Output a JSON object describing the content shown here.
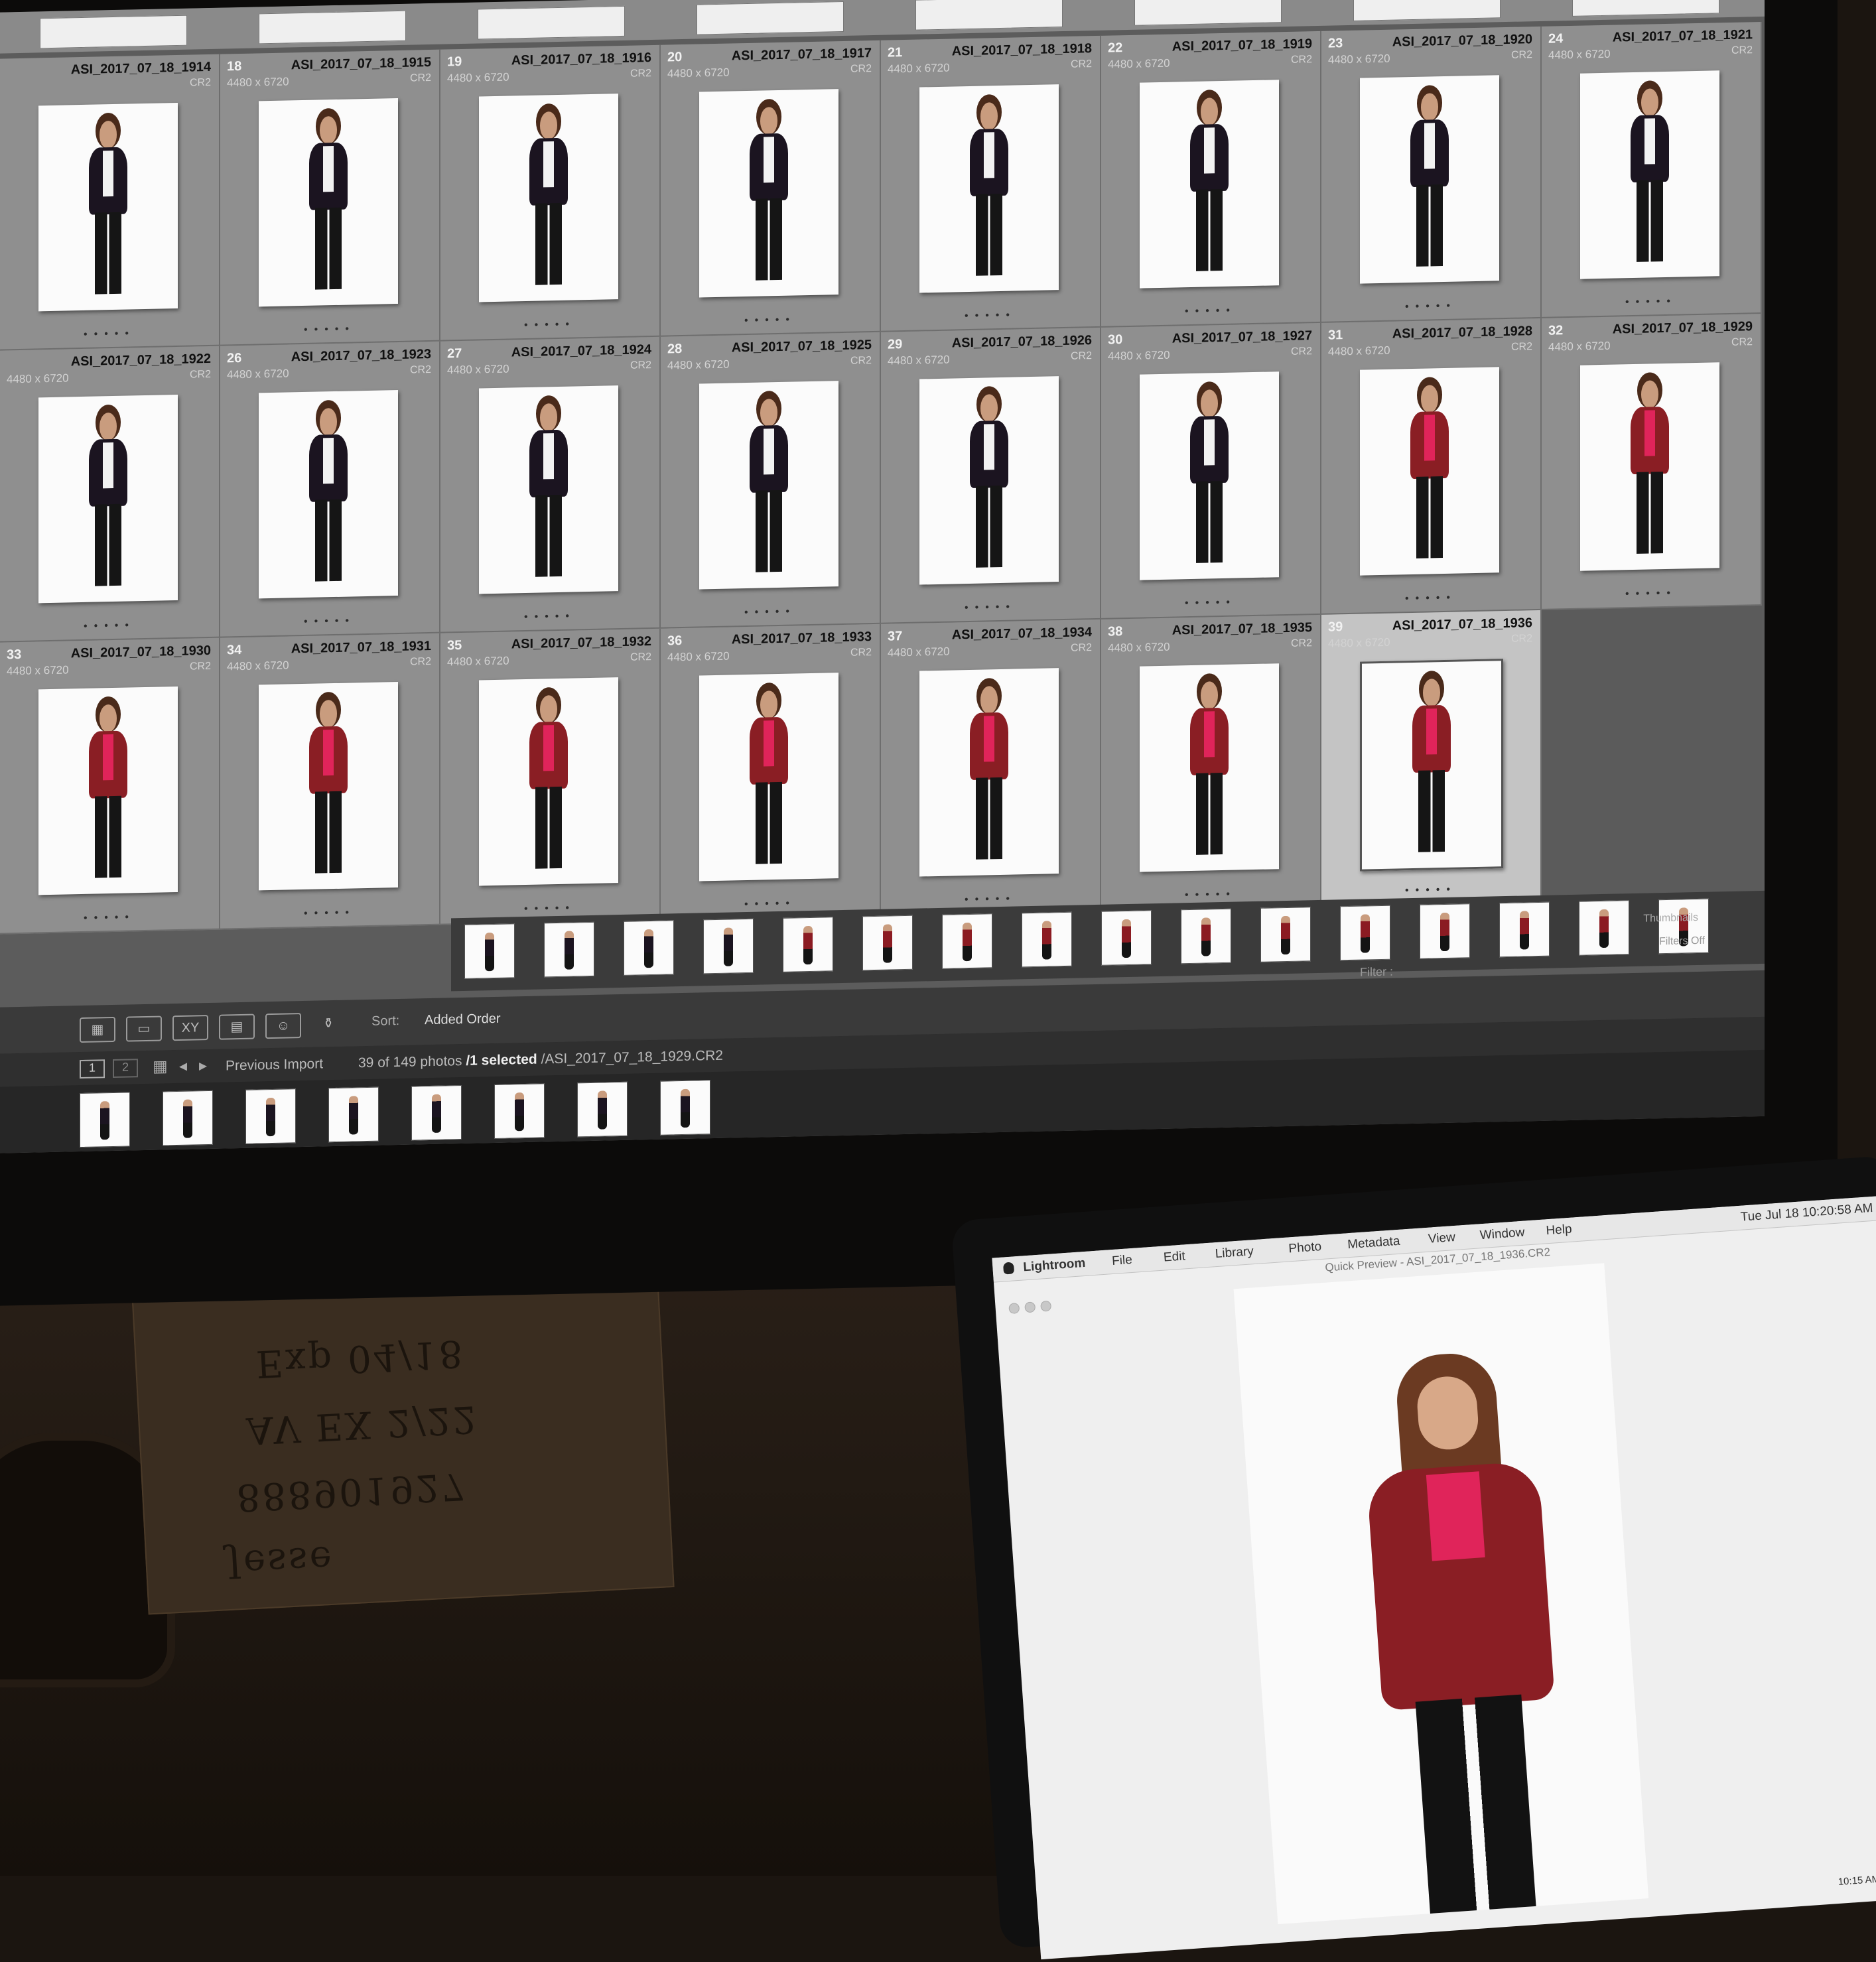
{
  "top_strip_cells": 8,
  "grid_rows": [
    [
      {
        "num": "",
        "file": "ASI_2017_07_18_1914",
        "dims": "",
        "ext": "CR2",
        "outfit": "black"
      },
      {
        "num": "18",
        "file": "ASI_2017_07_18_1915",
        "dims": "4480 x 6720",
        "ext": "CR2",
        "outfit": "black"
      },
      {
        "num": "19",
        "file": "ASI_2017_07_18_1916",
        "dims": "4480 x 6720",
        "ext": "CR2",
        "outfit": "black"
      },
      {
        "num": "20",
        "file": "ASI_2017_07_18_1917",
        "dims": "4480 x 6720",
        "ext": "CR2",
        "outfit": "black"
      },
      {
        "num": "21",
        "file": "ASI_2017_07_18_1918",
        "dims": "4480 x 6720",
        "ext": "CR2",
        "outfit": "black"
      },
      {
        "num": "22",
        "file": "ASI_2017_07_18_1919",
        "dims": "4480 x 6720",
        "ext": "CR2",
        "outfit": "black"
      },
      {
        "num": "23",
        "file": "ASI_2017_07_18_1920",
        "dims": "4480 x 6720",
        "ext": "CR2",
        "outfit": "black"
      },
      {
        "num": "24",
        "file": "ASI_2017_07_18_1921",
        "dims": "4480 x 6720",
        "ext": "CR2",
        "outfit": "black"
      }
    ],
    [
      {
        "num": "",
        "file": "ASI_2017_07_18_1922",
        "dims": "4480 x 6720",
        "ext": "CR2",
        "outfit": "black"
      },
      {
        "num": "26",
        "file": "ASI_2017_07_18_1923",
        "dims": "4480 x 6720",
        "ext": "CR2",
        "outfit": "black"
      },
      {
        "num": "27",
        "file": "ASI_2017_07_18_1924",
        "dims": "4480 x 6720",
        "ext": "CR2",
        "outfit": "black"
      },
      {
        "num": "28",
        "file": "ASI_2017_07_18_1925",
        "dims": "4480 x 6720",
        "ext": "CR2",
        "outfit": "black"
      },
      {
        "num": "29",
        "file": "ASI_2017_07_18_1926",
        "dims": "4480 x 6720",
        "ext": "CR2",
        "outfit": "black"
      },
      {
        "num": "30",
        "file": "ASI_2017_07_18_1927",
        "dims": "4480 x 6720",
        "ext": "CR2",
        "outfit": "black"
      },
      {
        "num": "31",
        "file": "ASI_2017_07_18_1928",
        "dims": "4480 x 6720",
        "ext": "CR2",
        "outfit": "red"
      },
      {
        "num": "32",
        "file": "ASI_2017_07_18_1929",
        "dims": "4480 x 6720",
        "ext": "CR2",
        "outfit": "red"
      }
    ],
    [
      {
        "num": "33",
        "file": "ASI_2017_07_18_1930",
        "dims": "4480 x 6720",
        "ext": "CR2",
        "outfit": "red"
      },
      {
        "num": "34",
        "file": "ASI_2017_07_18_1931",
        "dims": "4480 x 6720",
        "ext": "CR2",
        "outfit": "red"
      },
      {
        "num": "35",
        "file": "ASI_2017_07_18_1932",
        "dims": "4480 x 6720",
        "ext": "CR2",
        "outfit": "red"
      },
      {
        "num": "36",
        "file": "ASI_2017_07_18_1933",
        "dims": "4480 x 6720",
        "ext": "CR2",
        "outfit": "red"
      },
      {
        "num": "37",
        "file": "ASI_2017_07_18_1934",
        "dims": "4480 x 6720",
        "ext": "CR2",
        "outfit": "red"
      },
      {
        "num": "38",
        "file": "ASI_2017_07_18_1935",
        "dims": "4480 x 6720",
        "ext": "CR2",
        "outfit": "red"
      },
      {
        "num": "39",
        "file": "ASI_2017_07_18_1936",
        "dims": "4480 x 6720",
        "ext": "CR2",
        "outfit": "red",
        "selected": true
      }
    ]
  ],
  "toolbar": {
    "sort_label": "Sort:",
    "sort_value": "Added Order",
    "thumbnails_label": "Thumbnails",
    "filter_label": "Filter :",
    "filters_off": "Filters Off",
    "icons": [
      "grid-view-icon",
      "loupe-view-icon",
      "compare-view-icon",
      "survey-view-icon",
      "people-view-icon",
      "spray-can-icon"
    ]
  },
  "filmstrip": {
    "page1": "1",
    "page2": "2",
    "source": "Previous Import",
    "count": "39 of 149 photos",
    "selected_text": "/1 selected",
    "filename": "/ASI_2017_07_18_1929.CR2",
    "thumbs_upper": 16,
    "thumbs_lower": 8
  },
  "laptop": {
    "app": "Lightroom",
    "menu": [
      "File",
      "Edit",
      "Library",
      "Photo",
      "Metadata",
      "View",
      "Window",
      "Help"
    ],
    "title": "Quick Preview - ASI_2017_07_18_1936.CR2",
    "clock": "Tue Jul 18 10:20:58 AM",
    "dock_time": "10:15 AM"
  },
  "note": {
    "lines": [
      "Jesse",
      "888901927",
      "AV EX 2/22",
      "Exp 04/18"
    ]
  },
  "colors": {
    "grid_bg": "#8f8f8f",
    "selected_cell": "#c4c4c4",
    "black_outfit": "#1b1420",
    "red_outfit": "#8a1e24",
    "pink_top": "#e0245a"
  }
}
